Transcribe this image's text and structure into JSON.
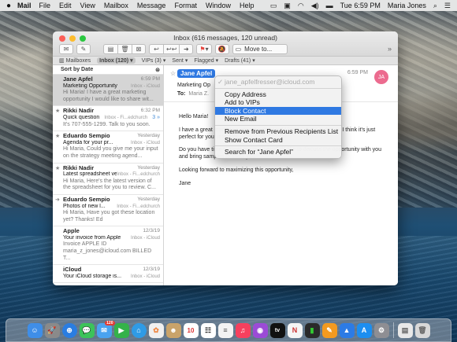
{
  "menubar": {
    "app_name": "Mail",
    "items": [
      "File",
      "Edit",
      "View",
      "Mailbox",
      "Message",
      "Format",
      "Window",
      "Help"
    ],
    "clock": "Tue 6:59 PM",
    "user": "Maria Jones"
  },
  "window": {
    "title": "Inbox (616 messages, 120 unread)",
    "move_to": "Move to..."
  },
  "favorites": {
    "mailboxes": "Mailboxes",
    "inbox": "Inbox (120)",
    "vips": "VIPs (3)",
    "sent": "Sent",
    "flagged": "Flagged",
    "drafts": "Drafts (41)"
  },
  "list": {
    "sort_label": "Sort by Date",
    "messages": [
      {
        "sender": "Jane Apfel",
        "date": "6:59 PM",
        "subject": "Marketing Opportunity",
        "mailbox": "Inbox - iCloud",
        "preview": "Hi Maria! I have a great marketing opportunity I would like to share wit...",
        "marker": ""
      },
      {
        "sender": "Rikki Nadir",
        "date": "6:32 PM",
        "subject": "Quick question",
        "mailbox": "Inbox - Fi...edchurch",
        "preview": "It's 707-555-1299. Talk to you soon.",
        "marker": "★",
        "thread": "3"
      },
      {
        "sender": "Eduardo Sempio",
        "date": "Yesterday",
        "subject": "Agenda for your pr...",
        "mailbox": "Inbox - iCloud",
        "preview": "Hi Maria, Could you give me your input on the strategy meeting agend...",
        "marker": "★"
      },
      {
        "sender": "Rikki Nadir",
        "date": "Yesterday",
        "subject": "Latest spreadsheet ver...",
        "mailbox": "Inbox - Fi...edchurch",
        "preview": "Hi Maria, Here's the latest version of the spreadsheet for you to review. C...",
        "marker": "★"
      },
      {
        "sender": "Eduardo Sempio",
        "date": "Yesterday",
        "subject": "Photos of new l...",
        "mailbox": "Inbox - Fi...edchurch",
        "preview": "Hi Maria, Have you got these location yet? Thanks! Ed",
        "marker": "➜"
      },
      {
        "sender": "Apple",
        "date": "12/3/19",
        "subject": "Your invoice from Apple",
        "mailbox": "Inbox - iCloud",
        "preview": "Invoice APPLE ID maria_z_jones@icloud.com BILLED T...",
        "marker": ""
      },
      {
        "sender": "iCloud",
        "date": "12/3/19",
        "subject": "Your iCloud storage is...",
        "mailbox": "Inbox - iCloud",
        "preview": "",
        "marker": ""
      }
    ]
  },
  "reader": {
    "from_name": "Jane Apfel",
    "date": "6:59 PM",
    "avatar_initials": "JA",
    "subject": "Marketing Op",
    "to_label": "To:",
    "to_value": "Maria Z.",
    "greeting": "Hello Maria!",
    "para1": "I have a great marketing opportunity I would like to share with you. I think it's just perfect for your interests",
    "para2": "Do you have time to meet me this week? I'd like to discuss the opportunity with you and bring samples to show you.",
    "para3": "Looking forward to maximizing this opportunity,",
    "signoff": "Jane"
  },
  "context_menu": {
    "email": "jane_apfelfresser@icloud.com",
    "copy_address": "Copy Address",
    "add_to_vips": "Add to VIPs",
    "block_contact": "Block Contact",
    "new_email": "New Email",
    "remove_recents": "Remove from Previous Recipients List",
    "show_contact_card": "Show Contact Card",
    "search_for": "Search for “Jane Apfel”"
  },
  "dock": {
    "calendar_day": "10",
    "mail_badge": "120",
    "tv_label": "tv"
  },
  "colors": {
    "accent": "#2f79e2",
    "avatar": "#ec6b8f"
  }
}
